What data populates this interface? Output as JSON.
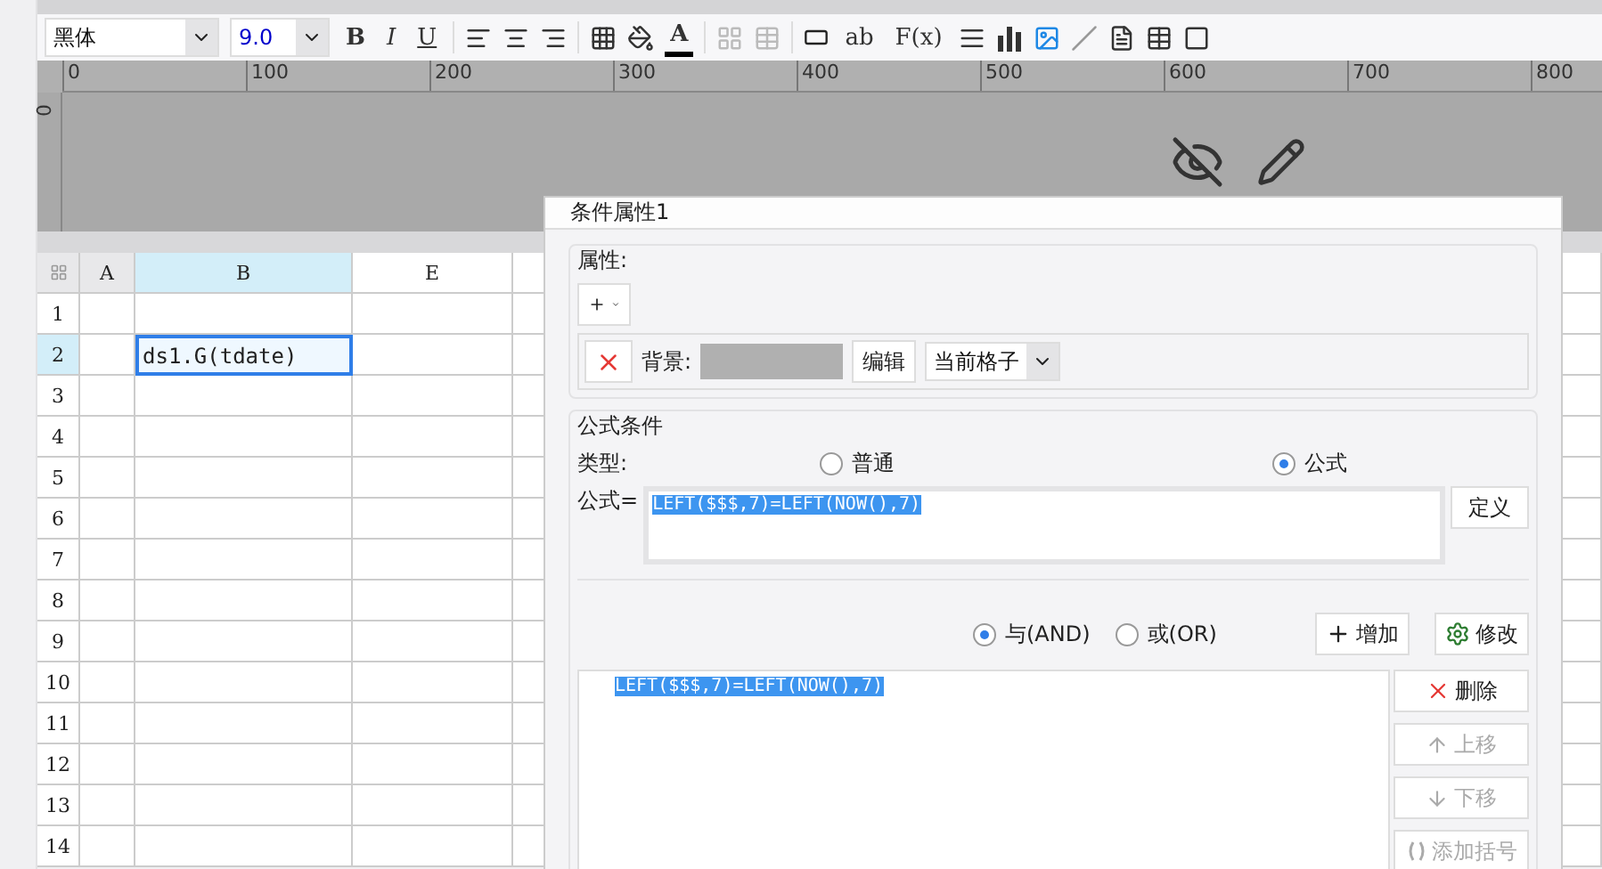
{
  "toolbar": {
    "font_name": "黑体",
    "font_size": "9.0",
    "buttons": [
      {
        "kind": "bold",
        "label": "B"
      },
      {
        "kind": "italic",
        "label": "I"
      },
      {
        "kind": "underline",
        "label": "U"
      },
      {
        "kind": "fontcolor",
        "label": "A"
      },
      {
        "kind": "textbox",
        "label": "ab"
      },
      {
        "kind": "formula",
        "label": "F(x)"
      }
    ]
  },
  "ruler": {
    "x_ticks": [
      "0",
      "100",
      "200",
      "300",
      "400",
      "500",
      "600",
      "700",
      "800"
    ],
    "y_tick": "0"
  },
  "sheet": {
    "columns": [
      {
        "label": "A",
        "selected": false
      },
      {
        "label": "B",
        "selected": true
      },
      {
        "label": "E",
        "selected": false
      }
    ],
    "rows": [
      {
        "label": "1",
        "selected": false
      },
      {
        "label": "2",
        "selected": true
      },
      {
        "label": "3",
        "selected": false
      },
      {
        "label": "4",
        "selected": false
      },
      {
        "label": "5",
        "selected": false
      },
      {
        "label": "6",
        "selected": false
      },
      {
        "label": "7",
        "selected": false
      },
      {
        "label": "8",
        "selected": false
      },
      {
        "label": "9",
        "selected": false
      },
      {
        "label": "10",
        "selected": false
      },
      {
        "label": "11",
        "selected": false
      },
      {
        "label": "12",
        "selected": false
      },
      {
        "label": "13",
        "selected": false
      },
      {
        "label": "14",
        "selected": false
      }
    ],
    "active_cell": "ds1.G(tdate)"
  },
  "dialog": {
    "title": "条件属性1",
    "attributes": {
      "legend": "属性:",
      "background_label": "背景:",
      "edit_button": "编辑",
      "scope": "当前格子"
    },
    "formula_condition": {
      "legend": "公式条件",
      "type_label": "类型:",
      "types": [
        {
          "label": "普通",
          "selected": false
        },
        {
          "label": "公式",
          "selected": true
        }
      ],
      "formula_label": "公式=",
      "formula": "LEFT($$$,7)=LEFT(NOW(),7)",
      "define_button": "定义",
      "joins": [
        {
          "label": "与(AND)",
          "selected": true
        },
        {
          "label": "或(OR)",
          "selected": false
        }
      ],
      "add_button": "增加",
      "modify_button": "修改",
      "conditions": [
        {
          "text": "LEFT($$$,7)=LEFT(NOW(),7)",
          "selected": true
        }
      ],
      "side_buttons": [
        {
          "kind": "delete",
          "label": "删除",
          "disabled": false
        },
        {
          "kind": "up",
          "label": "上移",
          "disabled": true
        },
        {
          "kind": "down",
          "label": "下移",
          "disabled": true
        },
        {
          "kind": "bracket",
          "label": "添加括号",
          "disabled": true
        }
      ]
    }
  }
}
